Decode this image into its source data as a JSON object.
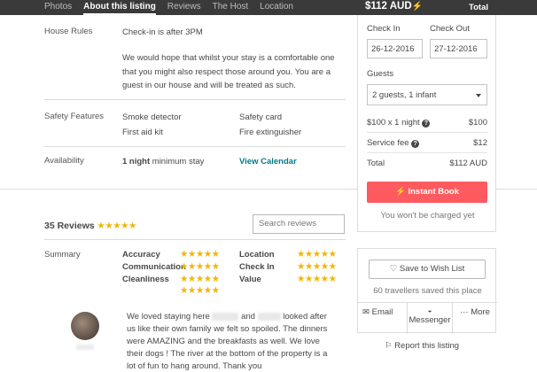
{
  "nav": {
    "items": [
      {
        "label": "Photos"
      },
      {
        "label": "About this listing"
      },
      {
        "label": "Reviews"
      },
      {
        "label": "The Host"
      },
      {
        "label": "Location"
      }
    ]
  },
  "house_rules": {
    "label": "House Rules",
    "checkin": "Check-in is after 3PM",
    "text": "We would hope that whilst your stay is a comfortable one that you might also respect those around you. You are a guest in our house and will be treated as such."
  },
  "safety": {
    "label": "Safety Features",
    "items": [
      "Smoke detector",
      "Safety card",
      "First aid kit",
      "Fire extinguisher"
    ]
  },
  "availability": {
    "label": "Availability",
    "stay_bold": "1 night",
    "stay_rest": " minimum stay",
    "link": "View Calendar"
  },
  "reviews": {
    "count_label": "35 Reviews",
    "stars": "★★★★★",
    "search_placeholder": "Search reviews",
    "summary_label": "Summary",
    "categories": [
      {
        "label": "Accuracy",
        "stars": "★★★★★"
      },
      {
        "label": "Location",
        "stars": "★★★★★"
      },
      {
        "label": "Communication",
        "stars": "★★★★★"
      },
      {
        "label": "Check In",
        "stars": "★★★★★"
      },
      {
        "label": "Cleanliness",
        "stars": "★★★★★"
      },
      {
        "label": "Value",
        "stars": "★★★★★"
      },
      {
        "label": "",
        "stars": "★★★★★"
      }
    ],
    "review": {
      "p1": "We loved staying here",
      "p2": "and",
      "p3": "looked after us like their own family we felt so spoiled. The dinners were AMAZING and the breakfasts as well. We love their dogs ! The river at the bottom of the property is a lot of fun to hang around. Thank you"
    }
  },
  "booking": {
    "price": "$112 AUD",
    "total_label": "Total",
    "checkin_label": "Check In",
    "checkout_label": "Check Out",
    "checkin_value": "26-12-2016",
    "checkout_value": "27-12-2016",
    "guests_label": "Guests",
    "guests_value": "2 guests, 1 infant",
    "nightly_label": "$100 x 1 night",
    "nightly_amount": "$100",
    "service_label": "Service fee",
    "service_amount": "$12",
    "total_row_label": "Total",
    "total_amount": "$112 AUD",
    "instant_book": "Instant Book",
    "charge_note": "You won't be charged yet"
  },
  "wishlist": {
    "button": "Save to Wish List",
    "saved_note": "60 travellers saved this place",
    "share": [
      {
        "label": "Email"
      },
      {
        "label": "Messenger"
      },
      {
        "label": "More"
      }
    ],
    "report": "Report this listing"
  },
  "colors": {
    "accent": "#ff5a5f",
    "link": "#007a87",
    "star": "#f2b600",
    "header_bg": "#3a3a3a"
  }
}
